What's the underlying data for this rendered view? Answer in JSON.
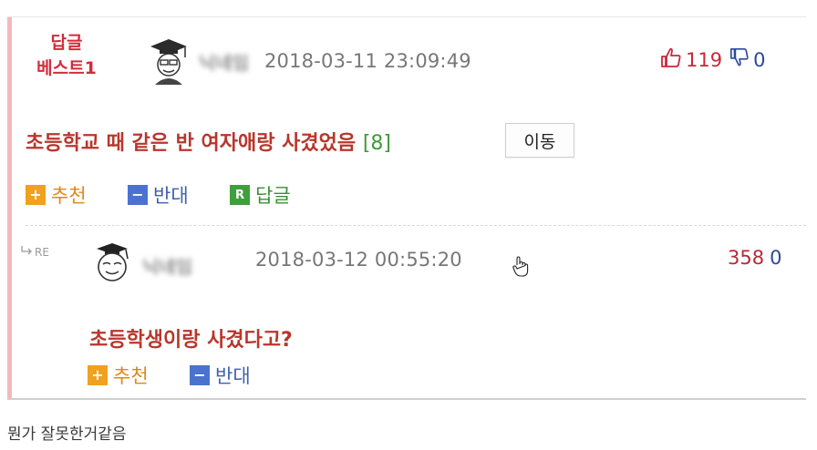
{
  "best_comment": {
    "badge_line1": "답글",
    "badge_line2": "베스트1",
    "username": "닉네임",
    "timestamp": "2018-03-11 23:09:49",
    "upvotes": "119",
    "downvotes": "0",
    "title": "초등학교 때 같은 반 여자애랑 사겼었음",
    "reply_count": "[8]",
    "move_button": "이동",
    "actions": {
      "recommend": "추천",
      "oppose": "반대",
      "reply": "답글"
    },
    "icon_glyphs": {
      "plus": "+",
      "minus": "−",
      "reply": "R"
    }
  },
  "reply_comment": {
    "re_label": "RE",
    "username": "닉네임",
    "timestamp": "2018-03-12 00:55:20",
    "upvotes": "358",
    "downvotes": "0",
    "text": "초등학생이랑 사겼다고?",
    "actions": {
      "recommend": "추천",
      "oppose": "반대"
    }
  },
  "caption": "뭔가 잘못한거같음",
  "colors": {
    "accent_bar": "#f2b8bd",
    "title_red": "#b8362c",
    "reply_count_green": "#3f9a3a",
    "recommend_orange": "#f0a11f",
    "oppose_blue": "#4b72cf",
    "reply_green": "#3f9f3c"
  },
  "icons": [
    "graduation-cap-avatar-icon",
    "thumbs-up-icon",
    "thumbs-down-icon",
    "reply-arrow-icon",
    "hand-cursor-icon"
  ]
}
